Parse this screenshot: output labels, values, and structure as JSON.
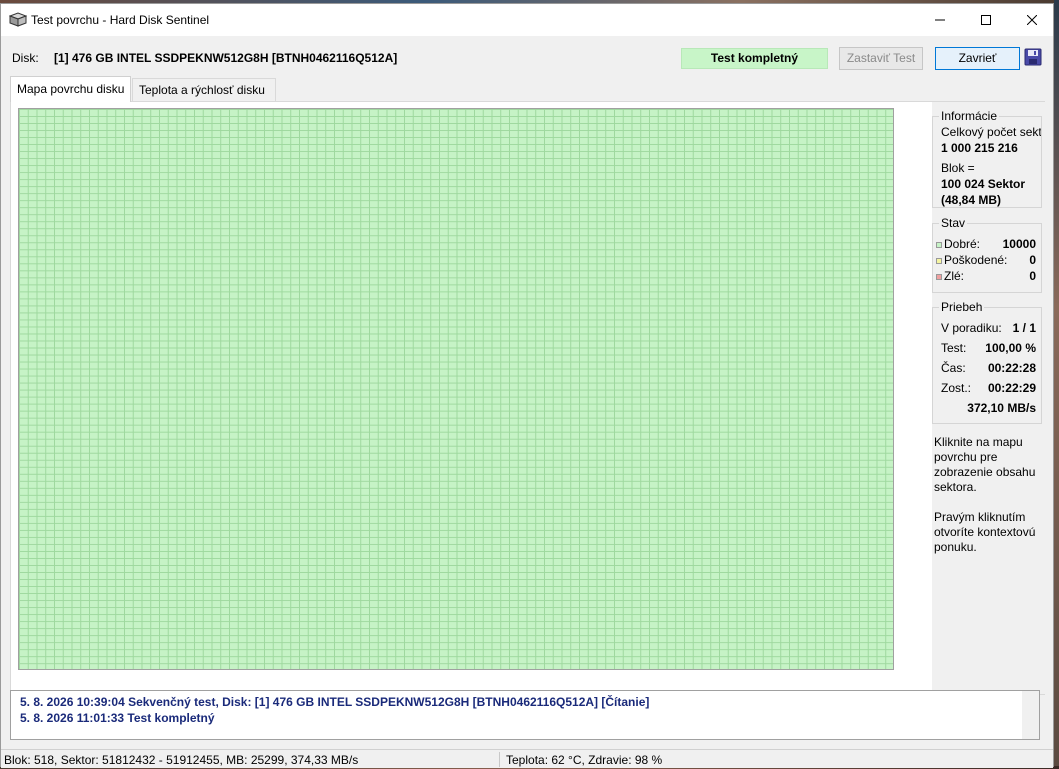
{
  "window": {
    "title": "Test povrchu - Hard Disk Sentinel"
  },
  "disk": {
    "label": "Disk:",
    "value": "[1] 476 GB  INTEL SSDPEKNW512G8H [BTNH0462116Q512A]"
  },
  "toolbar": {
    "status": "Test kompletný",
    "stop_label": "Zastaviť Test",
    "close_label": "Zavrieť",
    "status_color": "#c8f5c8"
  },
  "tabs": [
    {
      "label": "Mapa povrchu disku",
      "active": true
    },
    {
      "label": "Teplota a rýchlosť disku",
      "active": false
    }
  ],
  "map": {
    "block_color": "#c6f3c6",
    "grid_color": "#9ed89e"
  },
  "info": {
    "title": "Informácie",
    "total_label": "Celkový počet sektorov:",
    "total_value": "1 000 215 216",
    "block_label": "Blok =",
    "block_value": "100 024 Sektor",
    "block_size": "(48,84 MB)"
  },
  "stav": {
    "title": "Stav",
    "good_label": "Dobré:",
    "good_value": "10000",
    "damaged_label": "Poškodené:",
    "damaged_value": "0",
    "bad_label": "Zlé:",
    "bad_value": "0",
    "good_color": "#c6f3c6",
    "damaged_color": "#f5f5a0",
    "bad_color": "#f0a0a0"
  },
  "priebeh": {
    "title": "Priebeh",
    "order_label": "V poradiku:",
    "order_value": "1 / 1",
    "test_label": "Test:",
    "test_value": "100,00 %",
    "time_label": "Čas:",
    "time_value": "00:22:28",
    "remain_label": "Zost.:",
    "remain_value": "00:22:29",
    "speed_value": "372,10 MB/s"
  },
  "help": {
    "text1": "Kliknite na mapu povrchu pre zobrazenie obsahu sektora.",
    "text2": "Pravým kliknutím otvoríte kontextovú ponuku."
  },
  "log": [
    "5. 8. 2026  10:39:04   Sekvenčný test, Disk: [1] 476 GB  INTEL SSDPEKNW512G8H [BTNH0462116Q512A] [Čítanie]",
    "5. 8. 2026  11:01:33   Test kompletný"
  ],
  "statusbar": {
    "left": "Blok: 518, Sektor: 51812432 - 51912455, MB: 25299, 374,33 MB/s",
    "right": "Teplota: 62  °C,  Zdravie: 98 %"
  }
}
